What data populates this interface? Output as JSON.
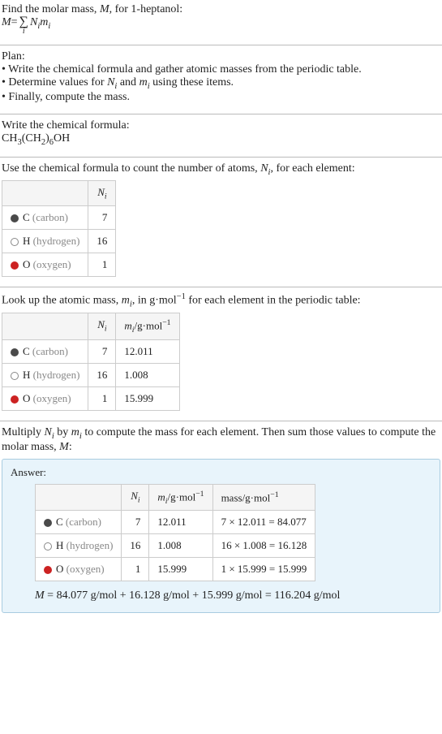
{
  "intro": {
    "line1_prefix": "Find the molar mass, ",
    "line1_var": "M",
    "line1_suffix": ", for 1-heptanol:",
    "eq_lhs": "M",
    "eq_eq": " = ",
    "sum_top": "∑",
    "sum_bottom": "i",
    "eq_rhs": " N",
    "eq_rhs_sub": "i",
    "eq_rhs2": "m",
    "eq_rhs2_sub": "i"
  },
  "plan": {
    "title": "Plan:",
    "b1": "• Write the chemical formula and gather atomic masses from the periodic table.",
    "b2_a": "• Determine values for ",
    "b2_ni": "N",
    "b2_ni_sub": "i",
    "b2_mid": " and ",
    "b2_mi": "m",
    "b2_mi_sub": "i",
    "b2_end": " using these items.",
    "b3": "• Finally, compute the mass."
  },
  "chem": {
    "title": "Write the chemical formula:",
    "p1": "CH",
    "s1": "3",
    "p2": "(CH",
    "s2": "2",
    "p3": ")",
    "s3": "6",
    "p4": "OH"
  },
  "count": {
    "line_a": "Use the chemical formula to count the number of atoms, ",
    "line_var": "N",
    "line_var_sub": "i",
    "line_b": ", for each element:",
    "col_ni": "N",
    "col_ni_sub": "i",
    "rows": [
      {
        "sym": "C",
        "name": " (carbon)",
        "n": "7"
      },
      {
        "sym": "H",
        "name": " (hydrogen)",
        "n": "16"
      },
      {
        "sym": "O",
        "name": " (oxygen)",
        "n": "1"
      }
    ]
  },
  "mass": {
    "line_a": "Look up the atomic mass, ",
    "line_var": "m",
    "line_var_sub": "i",
    "line_b": ", in g·mol",
    "line_b_sup": "−1",
    "line_c": " for each element in the periodic table:",
    "col_ni": "N",
    "col_ni_sub": "i",
    "col_mi_a": "m",
    "col_mi_sub": "i",
    "col_mi_b": "/g·mol",
    "col_mi_sup": "−1",
    "rows": [
      {
        "sym": "C",
        "name": " (carbon)",
        "n": "7",
        "m": "12.011"
      },
      {
        "sym": "H",
        "name": " (hydrogen)",
        "n": "16",
        "m": "1.008"
      },
      {
        "sym": "O",
        "name": " (oxygen)",
        "n": "1",
        "m": "15.999"
      }
    ]
  },
  "result": {
    "line_a": "Multiply ",
    "ni": "N",
    "ni_sub": "i",
    "line_b": " by ",
    "mi": "m",
    "mi_sub": "i",
    "line_c": " to compute the mass for each element. Then sum those values to compute the molar mass, ",
    "mvar": "M",
    "line_d": ":",
    "answer_label": "Answer:",
    "col_ni": "N",
    "col_ni_sub": "i",
    "col_mi_a": "m",
    "col_mi_sub": "i",
    "col_mi_b": "/g·mol",
    "col_mi_sup": "−1",
    "col_mass_a": "mass/g·mol",
    "col_mass_sup": "−1",
    "rows": [
      {
        "sym": "C",
        "name": " (carbon)",
        "n": "7",
        "m": "12.011",
        "calc": "7 × 12.011 = 84.077"
      },
      {
        "sym": "H",
        "name": " (hydrogen)",
        "n": "16",
        "m": "1.008",
        "calc": "16 × 1.008 = 16.128"
      },
      {
        "sym": "O",
        "name": " (oxygen)",
        "n": "1",
        "m": "15.999",
        "calc": "1 × 15.999 = 15.999"
      }
    ],
    "final_a": "M",
    "final_b": " = 84.077 g/mol + 16.128 g/mol + 15.999 g/mol = 116.204 g/mol"
  }
}
